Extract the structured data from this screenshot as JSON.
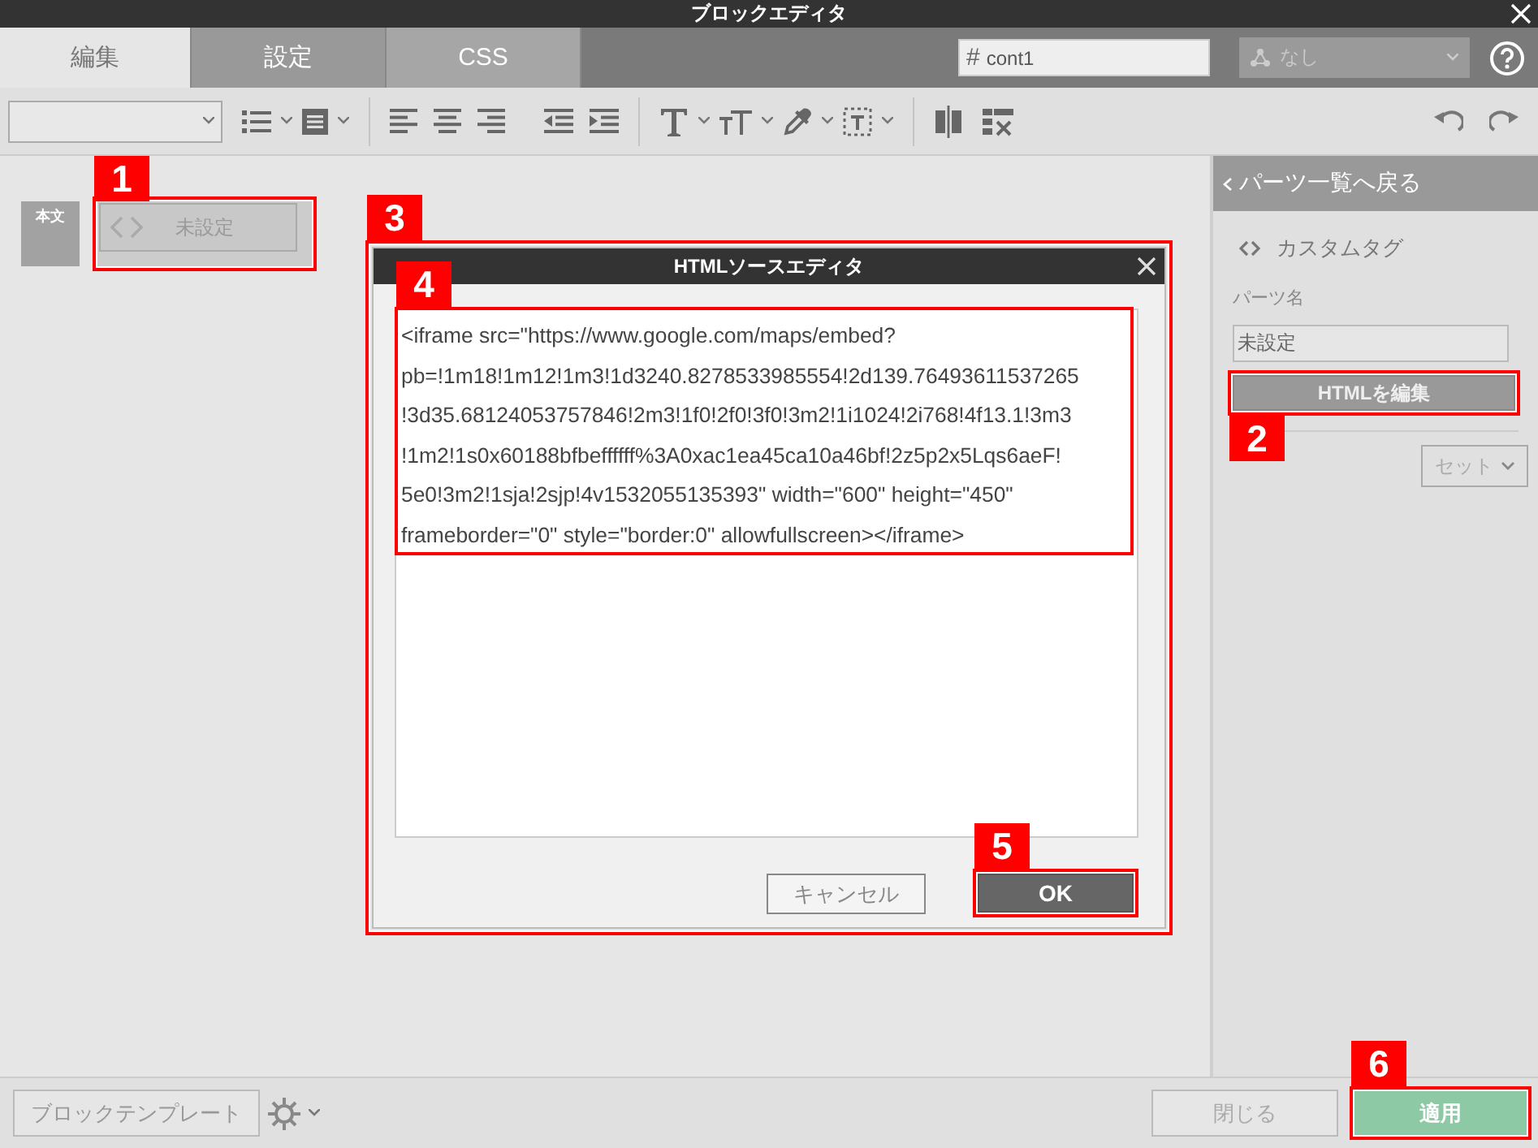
{
  "window": {
    "title": "ブロックエディタ"
  },
  "tabs": [
    {
      "label": "編集",
      "selected": true
    },
    {
      "label": "設定",
      "selected": false
    },
    {
      "label": "CSS",
      "selected": false
    }
  ],
  "id_field": {
    "prefix": "#",
    "value": "cont1"
  },
  "style_select": {
    "value": "なし",
    "disabled": true
  },
  "block": {
    "thumbnail_label": "本文",
    "button_label": "未設定"
  },
  "side_panel": {
    "back_link": "パーツ一覧へ戻る",
    "part_type": "カスタムタグ",
    "name_label": "パーツ名",
    "name_value": "未設定",
    "edit_button": "HTMLを編集",
    "set_button": "セット"
  },
  "dialog": {
    "title": "HTMLソースエディタ",
    "code_lines": [
      "<iframe src=\"https://www.google.com/maps/embed?",
      "pb=!1m18!1m12!1m3!1d3240.8278533985554!2d139.76493611537265",
      "!3d35.68124053757846!2m3!1f0!2f0!3f0!3m2!1i1024!2i768!4f13.1!3m3",
      "!1m2!1s0x60188bfbeffffff%3A0xac1ea45ca10a46bf!2z5p2x5Lqs6aeF!",
      "5e0!3m2!1sja!2sjp!4v1532055135393\" width=\"600\" height=\"450\"",
      "frameborder=\"0\" style=\"border:0\" allowfullscreen></iframe>"
    ],
    "cancel_button": "キャンセル",
    "ok_button": "OK"
  },
  "footer": {
    "template_button": "ブロックテンプレート",
    "close_button": "閉じる",
    "apply_button": "適用"
  },
  "callouts": [
    {
      "number": "1"
    },
    {
      "number": "2"
    },
    {
      "number": "3"
    },
    {
      "number": "4"
    },
    {
      "number": "5"
    },
    {
      "number": "6"
    }
  ]
}
